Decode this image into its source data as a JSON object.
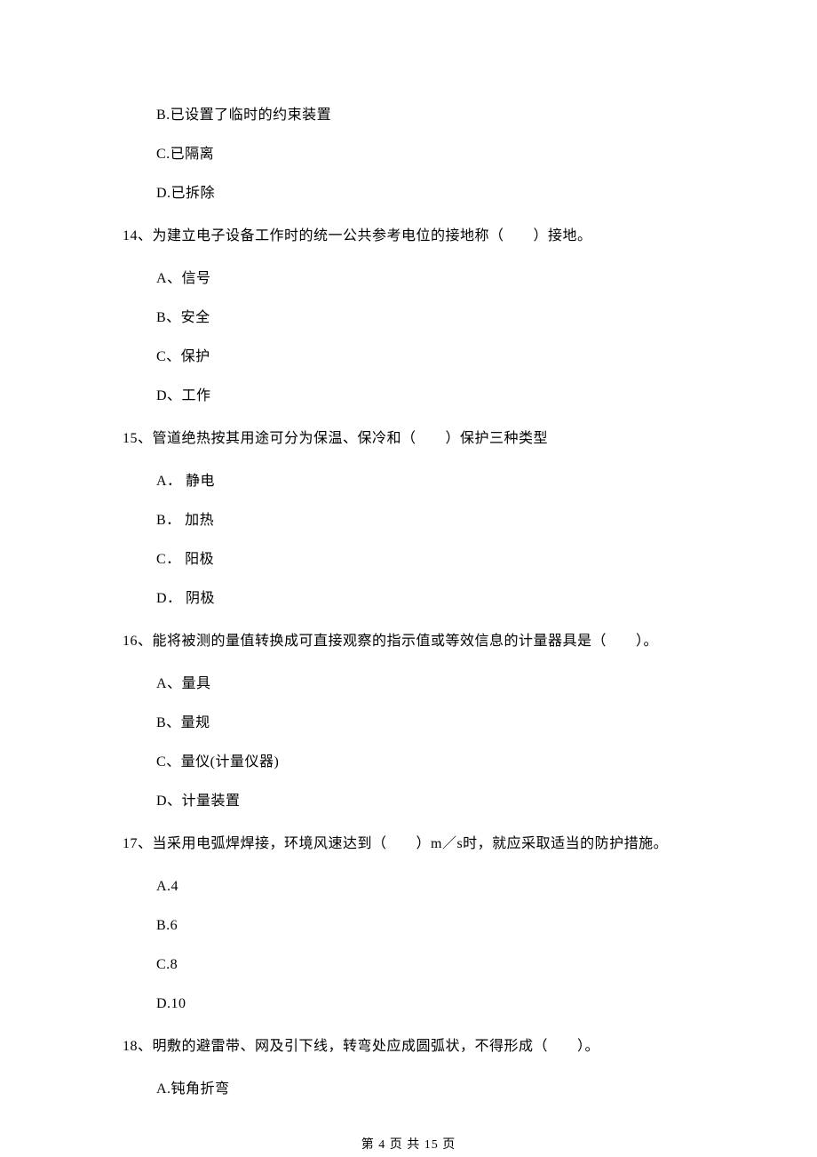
{
  "lead_options": [
    "B.已设置了临时的约束装置",
    "C.已隔离",
    "D.已拆除"
  ],
  "questions": [
    {
      "stem": "14、为建立电子设备工作时的统一公共参考电位的接地称（　　）接地。",
      "options": [
        "A、信号",
        "B、安全",
        "C、保护",
        "D、工作"
      ]
    },
    {
      "stem": "15、管道绝热按其用途可分为保温、保冷和（　　）保护三种类型",
      "options": [
        "A． 静电",
        "B． 加热",
        "C． 阳极",
        "D． 阴极"
      ]
    },
    {
      "stem": "16、能将被测的量值转换成可直接观察的指示值或等效信息的计量器具是（　　）。",
      "options": [
        "A、量具",
        "B、量规",
        "C、量仪(计量仪器)",
        "D、计量装置"
      ]
    },
    {
      "stem": "17、当采用电弧焊焊接，环境风速达到（　　）m／s时，就应采取适当的防护措施。",
      "options": [
        "A.4",
        "B.6",
        "C.8",
        "D.10"
      ]
    },
    {
      "stem": "18、明敷的避雷带、网及引下线，转弯处应成圆弧状，不得形成（　　）。",
      "options": [
        "A.钝角折弯"
      ]
    }
  ],
  "footer": "第 4 页 共 15 页"
}
